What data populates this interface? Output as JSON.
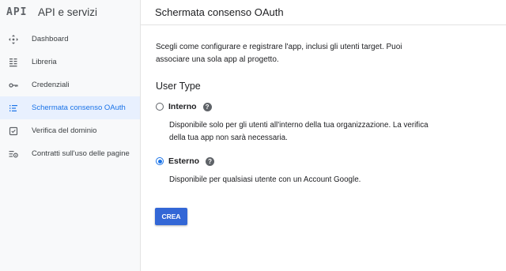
{
  "app": {
    "logo": "API",
    "title": "API e servizi"
  },
  "sidebar": {
    "items": [
      {
        "label": "Dashboard",
        "icon": "dashboard-icon",
        "active": false
      },
      {
        "label": "Libreria",
        "icon": "library-icon",
        "active": false
      },
      {
        "label": "Credenziali",
        "icon": "key-icon",
        "active": false
      },
      {
        "label": "Schermata consenso OAuth",
        "icon": "consent-icon",
        "active": true
      },
      {
        "label": "Verifica del dominio",
        "icon": "domain-check-icon",
        "active": false
      },
      {
        "label": "Contratti sull'uso delle pagine",
        "icon": "settings-list-icon",
        "active": false
      }
    ]
  },
  "main": {
    "header": "Schermata consenso OAuth",
    "intro": "Scegli come configurare e registrare l'app, inclusi gli utenti target. Puoi associare una sola app al progetto.",
    "section_title": "User Type",
    "options": [
      {
        "label": "Interno",
        "checked": false,
        "description": "Disponibile solo per gli utenti all'interno della tua organizzazione. La verifica della tua app non sarà necessaria."
      },
      {
        "label": "Esterno",
        "checked": true,
        "description": "Disponibile per qualsiasi utente con un Account Google."
      }
    ],
    "create_button": "CREA",
    "help_glyph": "?"
  },
  "colors": {
    "accent": "#1a73e8",
    "button": "#3367d6",
    "active_bg": "#e8f0fe",
    "sidebar_bg": "#f8f9fa"
  }
}
